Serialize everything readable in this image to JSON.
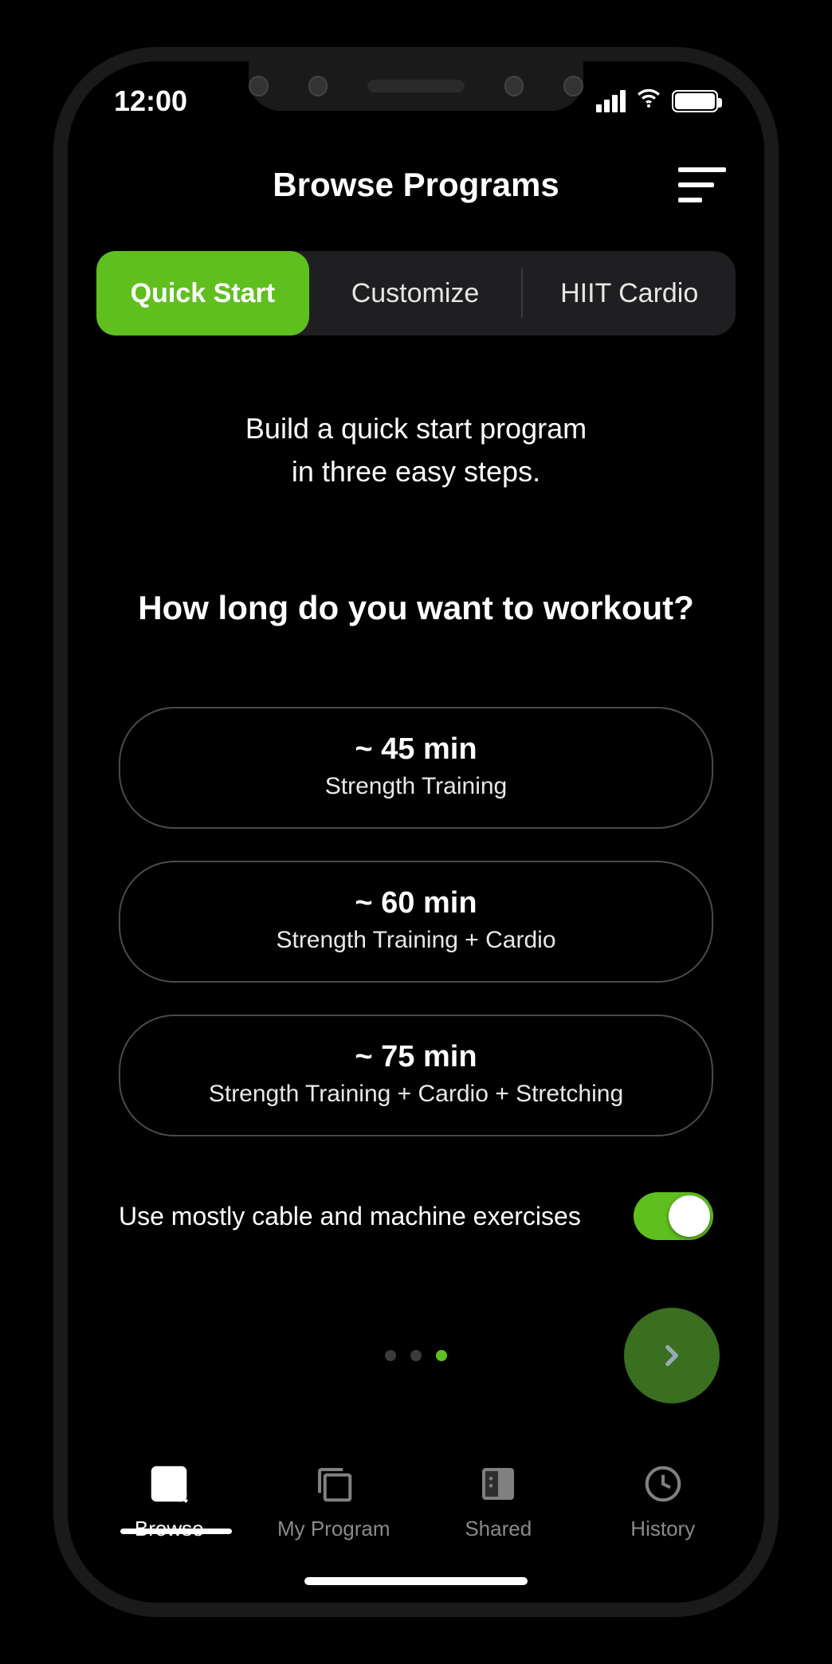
{
  "status": {
    "time": "12:00"
  },
  "header": {
    "title": "Browse Programs"
  },
  "tabs": [
    {
      "label": "Quick Start",
      "active": true
    },
    {
      "label": "Customize",
      "active": false
    },
    {
      "label": "HIIT Cardio",
      "active": false
    }
  ],
  "intro": {
    "line1": "Build a quick start program",
    "line2": "in three easy steps."
  },
  "question": "How long do you want to workout?",
  "options": [
    {
      "time": "~ 45 min",
      "desc": "Strength Training"
    },
    {
      "time": "~ 60 min",
      "desc": "Strength Training + Cardio"
    },
    {
      "time": "~ 75 min",
      "desc": "Strength Training + Cardio + Stretching"
    }
  ],
  "toggle": {
    "label": "Use mostly cable and machine exercises",
    "on": true
  },
  "pager": {
    "index": 2,
    "count": 3
  },
  "bottomTabs": [
    {
      "label": "Browse",
      "active": true
    },
    {
      "label": "My Program",
      "active": false
    },
    {
      "label": "Shared",
      "active": false
    },
    {
      "label": "History",
      "active": false
    }
  ]
}
